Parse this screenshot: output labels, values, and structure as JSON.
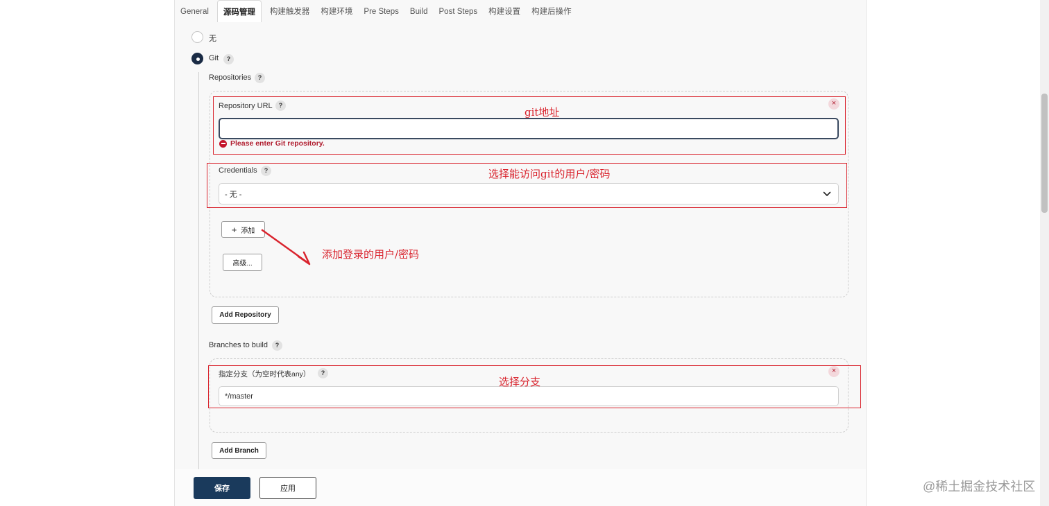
{
  "tabs": [
    "General",
    "源码管理",
    "构建触发器",
    "构建环境",
    "Pre Steps",
    "Build",
    "Post Steps",
    "构建设置",
    "构建后操作"
  ],
  "active_tab": "源码管理",
  "scm": {
    "option_none": "无",
    "option_git": "Git",
    "selected": "Git"
  },
  "repositories": {
    "label": "Repositories",
    "url_label": "Repository URL",
    "url_value": "",
    "url_error": "Please enter Git repository.",
    "credentials_label": "Credentials",
    "credentials_selected": "- 无 -",
    "add_button": "添加",
    "advanced_button": "高级...",
    "add_repository_button": "Add Repository"
  },
  "branches": {
    "label": "Branches to build",
    "spec_label": "指定分支（为空时代表any）",
    "spec_value": "*/master",
    "add_branch_button": "Add Branch"
  },
  "footer": {
    "save_button": "保存",
    "apply_button": "应用"
  },
  "annotations": {
    "git_url_note": "git地址",
    "credentials_note": "选择能访问git的用户/密码",
    "add_credentials_note": "添加登录的用户/密码",
    "branch_note": "选择分支"
  },
  "help_symbol": "?",
  "remove_symbol": "×",
  "watermark": "@稀土掘金技术社区",
  "colors": {
    "annotation_red": "#d9232d",
    "primary_button": "#1a3a5c",
    "error_red": "#b01c2e"
  }
}
